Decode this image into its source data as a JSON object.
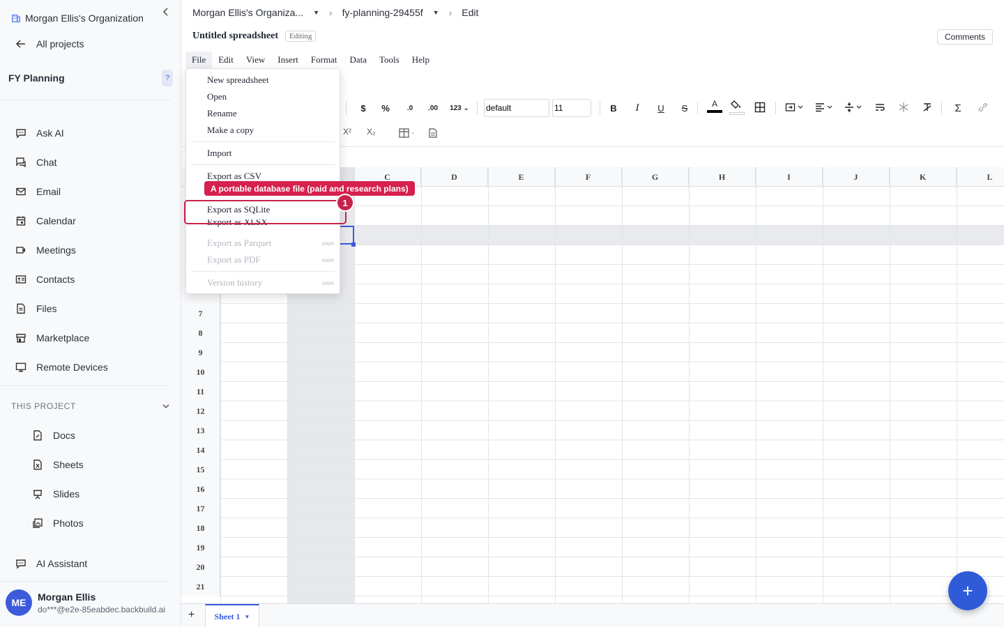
{
  "sidebar": {
    "org_name": "Morgan Ellis's Organization",
    "all_projects": "All projects",
    "project_name": "FY Planning",
    "help": "?",
    "nav": [
      {
        "label": "Ask AI",
        "icon": "chat-bubble-icon"
      },
      {
        "label": "Chat",
        "icon": "chat-icon"
      },
      {
        "label": "Email",
        "icon": "mail-icon"
      },
      {
        "label": "Calendar",
        "icon": "calendar-icon"
      },
      {
        "label": "Meetings",
        "icon": "video-icon"
      },
      {
        "label": "Contacts",
        "icon": "contacts-icon"
      },
      {
        "label": "Files",
        "icon": "files-icon"
      },
      {
        "label": "Marketplace",
        "icon": "store-icon"
      },
      {
        "label": "Remote Devices",
        "icon": "monitor-icon"
      }
    ],
    "section_title": "THIS PROJECT",
    "project_items": [
      {
        "label": "Docs",
        "icon": "doc-icon"
      },
      {
        "label": "Sheets",
        "icon": "sheet-icon"
      },
      {
        "label": "Slides",
        "icon": "slides-icon"
      },
      {
        "label": "Photos",
        "icon": "photo-icon"
      }
    ],
    "ai_assistant": "AI Assistant",
    "user": {
      "initials": "ME",
      "name": "Morgan Ellis",
      "email": "do***@e2e-85eabdec.backbuild.ai"
    }
  },
  "header": {
    "crumb_org": "Morgan Ellis's Organiza...",
    "crumb_project": "fy-planning-29455f",
    "crumb_mode": "Edit",
    "doc_title": "Untitled spreadsheet",
    "doc_status": "Editing",
    "comments": "Comments"
  },
  "menubar": [
    "File",
    "Edit",
    "View",
    "Insert",
    "Format",
    "Data",
    "Tools",
    "Help"
  ],
  "toolbar": {
    "font_name": "default",
    "font_size": "11",
    "number_format": "123"
  },
  "file_menu": {
    "items": [
      {
        "label": "New spreadsheet",
        "enabled": true
      },
      {
        "label": "Open",
        "enabled": true
      },
      {
        "label": "Rename",
        "enabled": true
      },
      {
        "label": "Make a copy",
        "enabled": true
      },
      {
        "label": "Import",
        "enabled": true
      },
      {
        "label": "Export as CSV",
        "enabled": true
      },
      {
        "label": "Export as SQLite",
        "enabled": true
      },
      {
        "label": "Export as XLSX",
        "enabled": true
      },
      {
        "label": "Export as Parquet",
        "enabled": false,
        "tag": "soon"
      },
      {
        "label": "Export as PDF",
        "enabled": false,
        "tag": "soon"
      },
      {
        "label": "Version history",
        "enabled": false,
        "tag": "soon"
      }
    ],
    "tooltip": "A portable database file (paid and research plans)",
    "marker": "1"
  },
  "grid": {
    "columns": [
      "C",
      "D",
      "E",
      "F",
      "G",
      "H",
      "I",
      "J",
      "K",
      "L"
    ],
    "rows": [
      "7",
      "8",
      "9",
      "10",
      "11",
      "12",
      "13",
      "14",
      "15",
      "16",
      "17",
      "18",
      "19",
      "20",
      "21"
    ]
  },
  "sheets": {
    "add": "+",
    "active": "Sheet 1"
  },
  "fab": "+"
}
